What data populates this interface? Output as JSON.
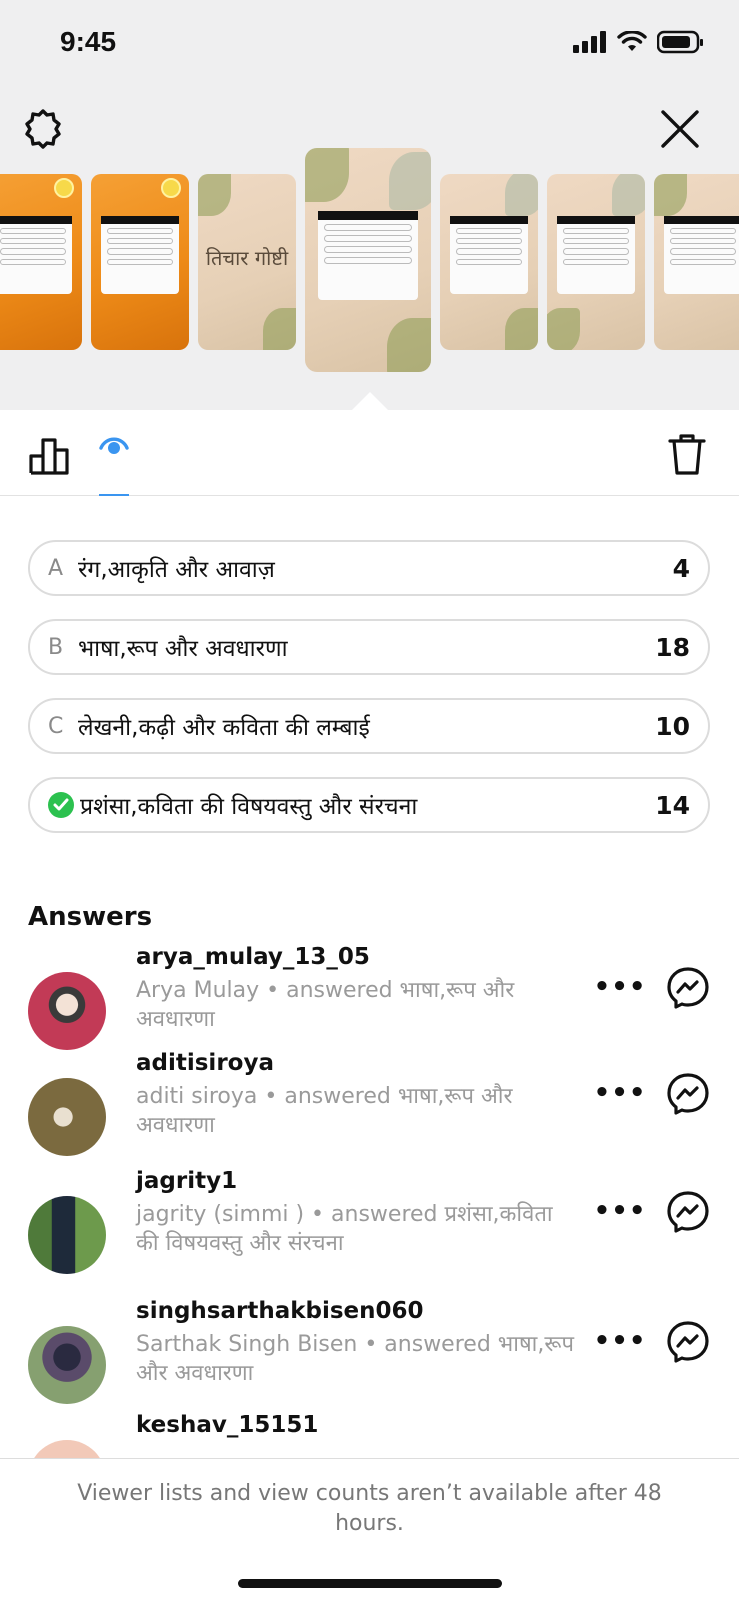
{
  "status_bar": {
    "time": "9:45"
  },
  "header": {
    "settings_icon": "gear-icon",
    "close_icon": "close-icon"
  },
  "thumbnails": [
    {
      "style": "orange",
      "kind": "quiz"
    },
    {
      "style": "orange",
      "kind": "quiz"
    },
    {
      "style": "beige",
      "kind": "title",
      "title": "तिचार गोष्टी"
    },
    {
      "style": "beige",
      "kind": "quiz",
      "active": true
    },
    {
      "style": "beige",
      "kind": "quiz"
    },
    {
      "style": "beige",
      "kind": "quiz"
    },
    {
      "style": "beige",
      "kind": "quiz"
    }
  ],
  "tabs": {
    "results_icon": "bar-chart-icon",
    "viewers_icon": "eye-icon",
    "delete_icon": "trash-icon",
    "accent": "#3a95f0"
  },
  "options": [
    {
      "letter": "A",
      "text": "रंग,आकृति और आवाज़",
      "count": "4",
      "correct": false
    },
    {
      "letter": "B",
      "text": "भाषा,रूप और अवधारणा",
      "count": "18",
      "correct": false
    },
    {
      "letter": "C",
      "text": "लेखनी,कढ़ी और कविता की लम्बाई",
      "count": "10",
      "correct": false
    },
    {
      "letter": "",
      "text": "प्रशंसा,कविता की विषयवस्तु और संरचना",
      "count": "14",
      "correct": true
    }
  ],
  "answers": {
    "heading": "Answers",
    "items": [
      {
        "username": "arya_mulay_13_05",
        "subtitle": "Arya Mulay • answered भाषा,रूप और अवधारणा"
      },
      {
        "username": "aditisiroya",
        "subtitle": "aditi siroya • answered भाषा,रूप और अवधारणा"
      },
      {
        "username": "jagrity1",
        "subtitle": "jagrity (simmi ) • answered प्रशंसा,कविता की विषयवस्तु और संरचना"
      },
      {
        "username": "singhsarthakbisen060",
        "subtitle": "Sarthak Singh Bisen • answered भाषा,रूप और अवधारणा"
      },
      {
        "username": "keshav_15151",
        "subtitle": ""
      }
    ],
    "more_label": "•••",
    "message_icon": "messenger-icon"
  },
  "footer": {
    "note": "Viewer lists and view counts aren’t available after 48 hours."
  },
  "colors": {
    "top_bg": "#efeff0",
    "correct": "#2cc14f",
    "secondary_text": "#9a9a9a"
  }
}
